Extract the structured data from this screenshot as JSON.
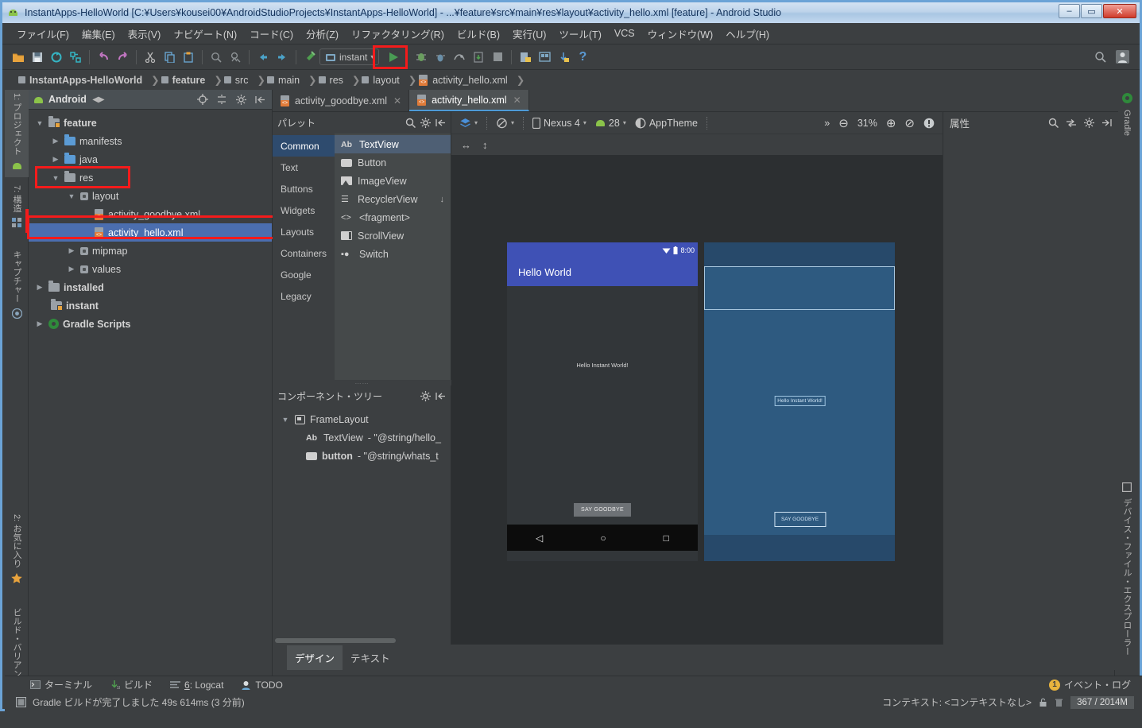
{
  "window": {
    "title": "InstantApps-HelloWorld [C:¥Users¥kousei00¥AndroidStudioProjects¥InstantApps-HelloWorld] - ...¥feature¥src¥main¥res¥layout¥activity_hello.xml [feature] - Android Studio",
    "minimize": "–",
    "maximize": "▭",
    "close": "✕"
  },
  "menubar": {
    "items": [
      "ファイル(F)",
      "編集(E)",
      "表示(V)",
      "ナビゲート(N)",
      "コード(C)",
      "分析(Z)",
      "リファクタリング(R)",
      "ビルド(B)",
      "実行(U)",
      "ツール(T)",
      "VCS",
      "ウィンドウ(W)",
      "ヘルプ(H)"
    ]
  },
  "toolbar": {
    "run_config_label": "instant",
    "icons": [
      "open-folder-icon",
      "save-all-icon",
      "sync-icon",
      "refresh-icon",
      "undo-icon",
      "redo-icon",
      "cut-icon",
      "copy-icon",
      "paste-icon",
      "find-icon",
      "find-usages-icon",
      "back-icon",
      "forward-icon",
      "build-hammer-icon",
      "run-icon",
      "debug-icon",
      "step-icon",
      "profiler-icon",
      "apply-changes-icon",
      "stop-icon",
      "sdk-manager-icon",
      "avd-manager-icon",
      "sync-gradle-icon",
      "help-icon",
      "search-everywhere-icon",
      "user-avatar-icon"
    ],
    "run_highlight_color": "#f41b1b"
  },
  "breadcrumb": {
    "items": [
      "InstantApps-HelloWorld",
      "feature",
      "src",
      "main",
      "res",
      "layout",
      "activity_hello.xml"
    ]
  },
  "left_strip": {
    "items": [
      {
        "label": "1: プロジェクト",
        "icon": "android-icon",
        "selected": true
      },
      {
        "label": "7: 構造",
        "icon": "structure-icon",
        "selected": false
      },
      {
        "label": "キャプチャー",
        "icon": "capture-icon",
        "selected": false
      },
      {
        "label": "2: お気に入り",
        "icon": "star-icon",
        "selected": false
      },
      {
        "label": "ビルド・バリアント",
        "icon": "android-icon",
        "selected": false
      }
    ]
  },
  "right_strip": {
    "top": {
      "label": "Gradle",
      "icon": "gradle-icon"
    },
    "bottom": {
      "label": "デバイス・ファイル・エクスプローラー",
      "icon": "device-icon"
    }
  },
  "project_panel": {
    "title": "Android",
    "header_icons": [
      "target-icon",
      "collapse-all-icon",
      "gear-icon",
      "hide-icon"
    ],
    "tree": [
      {
        "label": "feature",
        "depth": 0,
        "arrow": "▼",
        "icon": "module-folder-icon",
        "selected": false,
        "highlight": false
      },
      {
        "label": "manifests",
        "depth": 1,
        "arrow": "▶",
        "icon": "folder-blue-icon",
        "selected": false,
        "highlight": false
      },
      {
        "label": "java",
        "depth": 1,
        "arrow": "▶",
        "icon": "folder-blue-icon",
        "selected": false,
        "highlight": false
      },
      {
        "label": "res",
        "depth": 1,
        "arrow": "▼",
        "icon": "res-folder-icon",
        "selected": false,
        "highlight": true
      },
      {
        "label": "layout",
        "depth": 2,
        "arrow": "▼",
        "icon": "resource-dir-icon",
        "selected": false,
        "highlight": false
      },
      {
        "label": "activity_goodbye.xml",
        "depth": 3,
        "arrow": "",
        "icon": "xml-layout-icon",
        "selected": false,
        "highlight": false
      },
      {
        "label": "activity_hello.xml",
        "depth": 3,
        "arrow": "",
        "icon": "xml-layout-icon",
        "selected": true,
        "highlight": true
      },
      {
        "label": "mipmap",
        "depth": 2,
        "arrow": "▶",
        "icon": "resource-dir-icon",
        "selected": false,
        "highlight": false
      },
      {
        "label": "values",
        "depth": 2,
        "arrow": "▶",
        "icon": "resource-dir-icon",
        "selected": false,
        "highlight": false
      },
      {
        "label": "installed",
        "depth": 0,
        "arrow": "▶",
        "icon": "module-folder-green-icon",
        "selected": false,
        "highlight": false
      },
      {
        "label": "instant",
        "depth": 0,
        "arrow": "",
        "icon": "module-folder-instant-icon",
        "selected": false,
        "highlight": false
      },
      {
        "label": "Gradle Scripts",
        "depth": 0,
        "arrow": "▶",
        "icon": "gradle-icon",
        "selected": false,
        "highlight": false
      }
    ]
  },
  "editor_tabs": [
    {
      "label": "activity_goodbye.xml",
      "active": false,
      "close": "✕"
    },
    {
      "label": "activity_hello.xml",
      "active": true,
      "close": "✕"
    }
  ],
  "palette": {
    "title": "パレット",
    "header_icons": [
      "search-icon",
      "gear-icon",
      "hide-icon"
    ],
    "categories": [
      {
        "label": "Common",
        "selected": true
      },
      {
        "label": "Text",
        "selected": false
      },
      {
        "label": "Buttons",
        "selected": false
      },
      {
        "label": "Widgets",
        "selected": false
      },
      {
        "label": "Layouts",
        "selected": false
      },
      {
        "label": "Containers",
        "selected": false
      },
      {
        "label": "Google",
        "selected": false
      },
      {
        "label": "Legacy",
        "selected": false
      }
    ],
    "items": [
      {
        "label": "TextView",
        "icon": "textview-icon",
        "selected": true,
        "download": false
      },
      {
        "label": "Button",
        "icon": "button-icon",
        "selected": false,
        "download": false
      },
      {
        "label": "ImageView",
        "icon": "imageview-icon",
        "selected": false,
        "download": false
      },
      {
        "label": "RecyclerView",
        "icon": "recyclerview-icon",
        "selected": false,
        "download": true
      },
      {
        "label": "<fragment>",
        "icon": "fragment-icon",
        "selected": false,
        "download": false
      },
      {
        "label": "ScrollView",
        "icon": "scrollview-icon",
        "selected": false,
        "download": false
      },
      {
        "label": "Switch",
        "icon": "switch-icon",
        "selected": false,
        "download": false
      }
    ],
    "download_glyph": "↓"
  },
  "component_tree": {
    "title": "コンポーネント・ツリー",
    "header_icons": [
      "gear-icon",
      "hide-icon"
    ],
    "rows": [
      {
        "arrow": "▼",
        "icon": "framelayout-icon",
        "label": "FrameLayout",
        "suffix": "",
        "depth": 0,
        "bold": false
      },
      {
        "arrow": "",
        "icon": "textview-icon",
        "label": "TextView",
        "suffix": " - \"@string/hello_",
        "depth": 1,
        "bold": false
      },
      {
        "arrow": "",
        "icon": "button-icon",
        "label": "button",
        "suffix": " - \"@string/whats_t",
        "depth": 1,
        "bold": true
      }
    ]
  },
  "design_toolbar": {
    "design_mode_icon": "layers-icon",
    "orientation_icon": "orientation-icon",
    "device": "Nexus 4",
    "api_level": "28",
    "theme": "AppTheme",
    "overflow": "»",
    "zoom_out": "⊖",
    "zoom_level": "31%",
    "zoom_in": "⊕",
    "zoom_fit": "⊘",
    "issues_icon": "warning-icon",
    "device_icon": "phone-icon",
    "android_icon": "android-icon",
    "theme_icon": "theme-icon"
  },
  "design_subbar": {
    "width_icon": "horizontal-resize-icon",
    "height_icon": "vertical-resize-icon"
  },
  "preview": {
    "status_clock": "8:00",
    "wifi_icon": "wifi-icon",
    "battery_icon": "battery-icon",
    "appbar_title": "Hello World",
    "center_text": "Hello Instant World!",
    "button_label": "SAY GOODBYE",
    "nav_back": "◁",
    "nav_home": "○",
    "nav_recents": "□",
    "appbar_color": "#3f51b5"
  },
  "blueprint": {
    "center_text": "Hello Instant World!",
    "button_label": "SAY GOODBYE",
    "surface_color": "#2e5a80"
  },
  "bottom_tabs": [
    {
      "label": "デザイン",
      "selected": true
    },
    {
      "label": "テキスト",
      "selected": false
    }
  ],
  "attributes": {
    "title": "属性",
    "header_icons": [
      "search-icon",
      "sort-toggle-icon",
      "gear-icon",
      "hide-icon"
    ]
  },
  "bottom_tools": [
    {
      "label": "ターミナル",
      "icon": "terminal-icon"
    },
    {
      "label": "ビルド",
      "icon": "build-icon"
    },
    {
      "label": "6: Logcat",
      "icon": "logcat-icon"
    },
    {
      "label": "TODO",
      "icon": "todo-icon"
    }
  ],
  "statusbar": {
    "message": "Gradle ビルドが完了しました 49s 614ms (3 分前)",
    "message_icon": "build-status-icon",
    "event_log": "イベント・ログ",
    "event_count": "1",
    "context": "コンテキスト: <コンテキストなし>",
    "lock_icon": "lock-icon",
    "trash_icon": "trash-icon",
    "memory": "367 / 2014M"
  }
}
